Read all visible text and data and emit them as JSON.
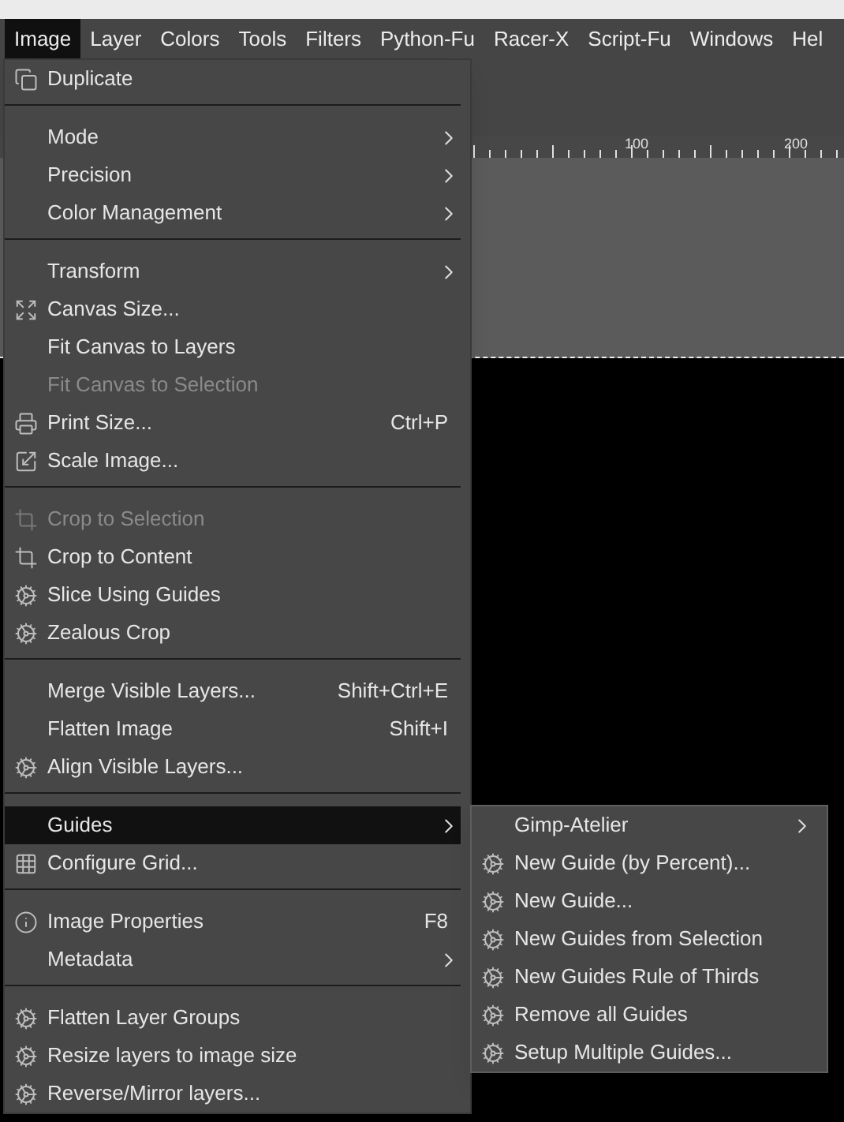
{
  "menubar": [
    {
      "label": "Image",
      "selected": true
    },
    {
      "label": "Layer",
      "selected": false
    },
    {
      "label": "Colors",
      "selected": false
    },
    {
      "label": "Tools",
      "selected": false
    },
    {
      "label": "Filters",
      "selected": false
    },
    {
      "label": "Python-Fu",
      "selected": false
    },
    {
      "label": "Racer-X",
      "selected": false
    },
    {
      "label": "Script-Fu",
      "selected": false
    },
    {
      "label": "Windows",
      "selected": false
    },
    {
      "label": "Hel",
      "selected": false
    }
  ],
  "ruler": {
    "labels": [
      "100",
      "200"
    ]
  },
  "image_menu": [
    {
      "kind": "duplicate",
      "label": "Duplicate",
      "disabled": false,
      "selected": false
    },
    {
      "kind": "separator"
    },
    {
      "kind": "submenu",
      "label": "Mode",
      "disabled": false,
      "selected": false
    },
    {
      "kind": "submenu",
      "label": "Precision",
      "disabled": false,
      "selected": false
    },
    {
      "kind": "submenu",
      "label": "Color Management",
      "disabled": false,
      "selected": false
    },
    {
      "kind": "separator"
    },
    {
      "kind": "submenu",
      "label": "Transform",
      "disabled": false,
      "selected": false
    },
    {
      "kind": "resize",
      "label": "Canvas Size...",
      "disabled": false,
      "selected": false
    },
    {
      "kind": "plain",
      "label": "Fit Canvas to Layers",
      "disabled": false,
      "selected": false
    },
    {
      "kind": "plain",
      "label": "Fit Canvas to Selection",
      "disabled": true,
      "selected": false
    },
    {
      "kind": "print",
      "label": "Print Size...",
      "shortcut": "Ctrl+P",
      "disabled": false,
      "selected": false
    },
    {
      "kind": "scale",
      "label": "Scale Image...",
      "disabled": false,
      "selected": false
    },
    {
      "kind": "separator"
    },
    {
      "kind": "crop",
      "label": "Crop to Selection",
      "disabled": true,
      "selected": false
    },
    {
      "kind": "crop",
      "label": "Crop to Content",
      "disabled": false,
      "selected": false
    },
    {
      "kind": "script",
      "label": "Slice Using Guides",
      "disabled": false,
      "selected": false
    },
    {
      "kind": "script",
      "label": "Zealous Crop",
      "disabled": false,
      "selected": false
    },
    {
      "kind": "separator"
    },
    {
      "kind": "plain",
      "label": "Merge Visible Layers...",
      "shortcut": "Shift+Ctrl+E",
      "disabled": false,
      "selected": false
    },
    {
      "kind": "plain",
      "label": "Flatten Image",
      "shortcut": "Shift+I",
      "disabled": false,
      "selected": false
    },
    {
      "kind": "script",
      "label": "Align Visible Layers...",
      "disabled": false,
      "selected": false
    },
    {
      "kind": "separator"
    },
    {
      "kind": "submenu",
      "label": "Guides",
      "disabled": false,
      "selected": true
    },
    {
      "kind": "grid",
      "label": "Configure Grid...",
      "disabled": false,
      "selected": false
    },
    {
      "kind": "separator"
    },
    {
      "kind": "info",
      "label": "Image Properties",
      "shortcut": "F8",
      "disabled": false,
      "selected": false
    },
    {
      "kind": "submenu",
      "label": "Metadata",
      "disabled": false,
      "selected": false
    },
    {
      "kind": "separator"
    },
    {
      "kind": "script",
      "label": "Flatten Layer Groups",
      "disabled": false,
      "selected": false
    },
    {
      "kind": "script",
      "label": "Resize layers to image size",
      "disabled": false,
      "selected": false
    },
    {
      "kind": "script",
      "label": "Reverse/Mirror layers...",
      "disabled": false,
      "selected": false
    }
  ],
  "guides_menu": [
    {
      "kind": "submenu",
      "label": "Gimp-Atelier",
      "disabled": false,
      "selected": false
    },
    {
      "kind": "script",
      "label": "New Guide (by Percent)...",
      "disabled": false,
      "selected": false
    },
    {
      "kind": "script",
      "label": "New Guide...",
      "disabled": false,
      "selected": false
    },
    {
      "kind": "script",
      "label": "New Guides from Selection",
      "disabled": false,
      "selected": false
    },
    {
      "kind": "script",
      "label": "New Guides Rule of Thirds",
      "disabled": false,
      "selected": false
    },
    {
      "kind": "script",
      "label": "Remove all Guides",
      "disabled": false,
      "selected": false
    },
    {
      "kind": "script",
      "label": "Setup Multiple Guides...",
      "disabled": false,
      "selected": false
    }
  ]
}
